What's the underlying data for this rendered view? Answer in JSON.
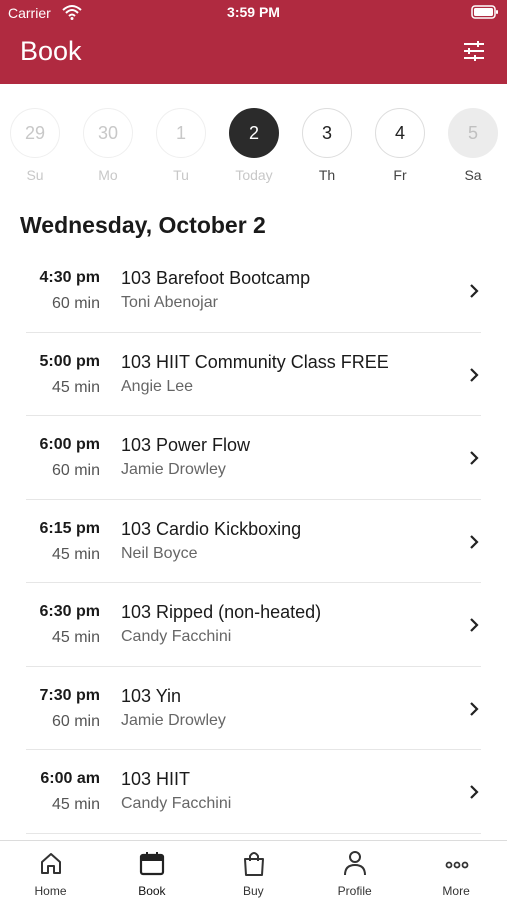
{
  "status_bar": {
    "carrier": "Carrier",
    "time": "3:59 PM"
  },
  "nav": {
    "title": "Book",
    "filter_icon": "sliders-icon"
  },
  "days": [
    {
      "num": "29",
      "label": "Su",
      "state": "past"
    },
    {
      "num": "30",
      "label": "Mo",
      "state": "past"
    },
    {
      "num": "1",
      "label": "Tu",
      "state": "past"
    },
    {
      "num": "2",
      "label": "Today",
      "state": "selected"
    },
    {
      "num": "3",
      "label": "Th",
      "state": "normal"
    },
    {
      "num": "4",
      "label": "Fr",
      "state": "normal"
    },
    {
      "num": "5",
      "label": "Sa",
      "state": "disabled"
    }
  ],
  "date_heading": "Wednesday, October 2",
  "sessions": [
    {
      "time": "4:30 pm",
      "duration": "60 min",
      "name": "103 Barefoot Bootcamp",
      "instructor": "Toni Abenojar"
    },
    {
      "time": "5:00 pm",
      "duration": "45 min",
      "name": "103 HIIT Community Class FREE",
      "instructor": "Angie Lee"
    },
    {
      "time": "6:00 pm",
      "duration": "60 min",
      "name": "103 Power Flow",
      "instructor": "Jamie Drowley"
    },
    {
      "time": "6:15 pm",
      "duration": "45 min",
      "name": "103 Cardio Kickboxing",
      "instructor": "Neil Boyce"
    },
    {
      "time": "6:30 pm",
      "duration": "45 min",
      "name": "103 Ripped (non-heated)",
      "instructor": "Candy Facchini"
    },
    {
      "time": "7:30 pm",
      "duration": "60 min",
      "name": "103 Yin",
      "instructor": "Jamie Drowley"
    },
    {
      "time": "6:00 am",
      "duration": "45 min",
      "name": "103 HIIT",
      "instructor": "Candy Facchini"
    }
  ],
  "tabs": [
    {
      "label": "Home",
      "icon": "home-icon"
    },
    {
      "label": "Book",
      "icon": "calendar-icon",
      "active": true
    },
    {
      "label": "Buy",
      "icon": "shopping-bag-icon"
    },
    {
      "label": "Profile",
      "icon": "person-icon"
    },
    {
      "label": "More",
      "icon": "more-dots-icon"
    }
  ],
  "colors": {
    "brand": "#b02a40",
    "selected_day": "#2b2b2b"
  }
}
